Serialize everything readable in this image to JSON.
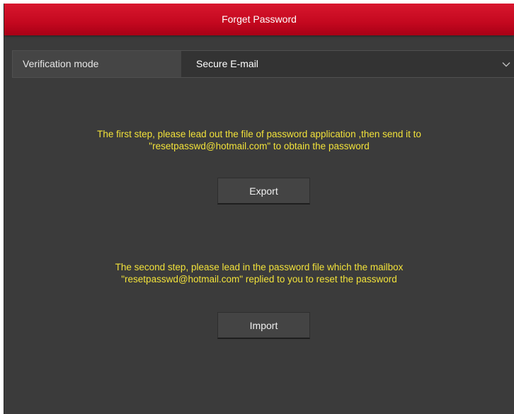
{
  "dialog": {
    "title": "Forget Password"
  },
  "verification": {
    "label": "Verification mode",
    "selected_value": "Secure E-mail",
    "dropdown_icon": "chevron-down-icon"
  },
  "step1": {
    "line1": "The first step, please lead out the file of password application ,then send it to",
    "line2": "\"resetpasswd@hotmail.com\" to obtain the password",
    "button_label": "Export"
  },
  "step2": {
    "line1": "The second step, please lead in the password file which the mailbox",
    "line2": "\"resetpasswd@hotmail.com\" replied to you to reset the password",
    "button_label": "Import"
  },
  "colors": {
    "title_bar": "#c4081f",
    "background": "#3b3b3b",
    "instruction_text": "#f2e23a"
  }
}
